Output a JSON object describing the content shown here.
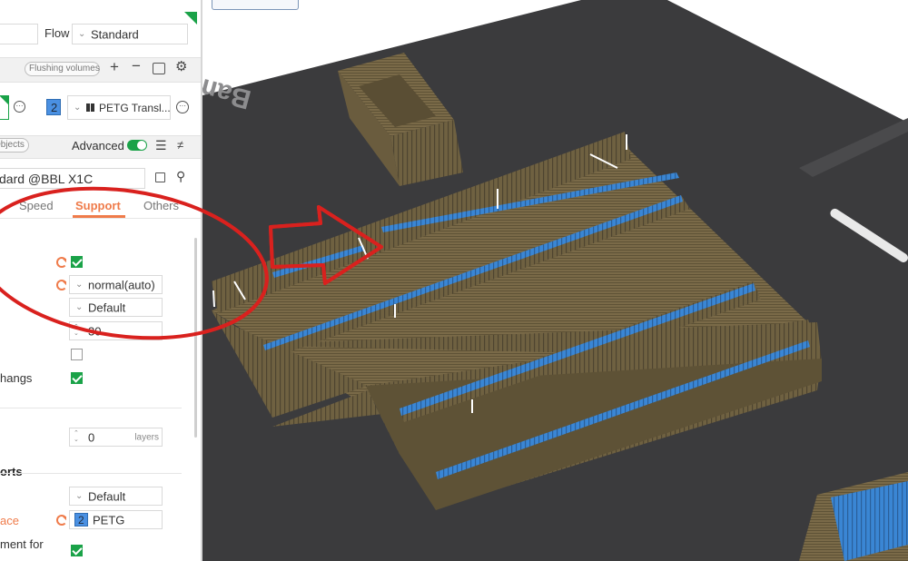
{
  "header": {
    "flow_label": "Flow",
    "flow_value": "Standard"
  },
  "filaments": {
    "flushing_label": "Flushing volumes",
    "add_icon": "plus-icon",
    "remove_icon": "minus-icon",
    "slot_number": "2",
    "slot_color": "#4a90e2",
    "material": "PETG Transl..."
  },
  "process": {
    "objects_label": "Objects",
    "advanced_label": "Advanced",
    "preset": "dard @BBL X1C",
    "tabs": [
      {
        "label": "Speed"
      },
      {
        "label": "Support"
      },
      {
        "label": "Others"
      }
    ]
  },
  "settings": {
    "type_value": "normal(auto)",
    "style_value": "Default",
    "threshold_value": "30",
    "overhangs_label": "hangs",
    "layers_value": "0",
    "layers_unit": "layers",
    "section_title": "orts",
    "support_filament_value": "Default",
    "interface_label": "ace",
    "interface_slot": "2",
    "interface_material": "PETG",
    "reduce_label": "ment for"
  },
  "bed": {
    "brand_text": "Bambu Smooth PEI Plate"
  },
  "colors": {
    "accent": "#ef7b4a",
    "green": "#1aa248",
    "bed": "#3b3b3d",
    "model": "#7a6a48",
    "support_blue": "#3a86d4",
    "annotation_red": "#d9211e"
  }
}
